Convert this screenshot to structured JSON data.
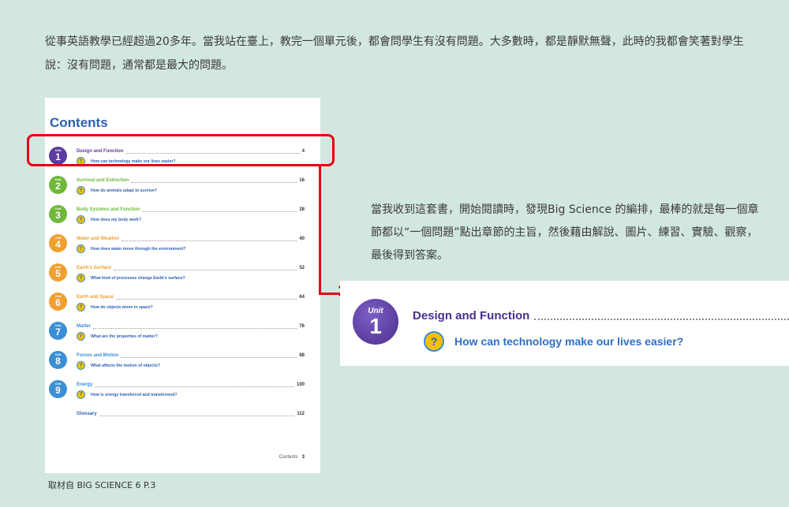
{
  "intro": {
    "text": "從事英語教學已經超過20多年。當我站在臺上，教完一個單元後，都會問學生有沒有問題。大多數時，都是靜默無聲，此時的我都會笑著對學生說：沒有問題，通常都是最大的問題。"
  },
  "toc": {
    "title": "Contents",
    "unit_word": "Unit",
    "units": [
      {
        "number": "1",
        "chapter": "Design and Function",
        "page": "4",
        "question": "How can technology make our lives easier?",
        "color": "#5b3c9e"
      },
      {
        "number": "2",
        "chapter": "Survival and Extinction",
        "page": "16",
        "question": "How do animals adapt to survive?",
        "color": "#6fb83b"
      },
      {
        "number": "3",
        "chapter": "Body Systems and Function",
        "page": "28",
        "question": "How does my body work?",
        "color": "#6fb83b"
      },
      {
        "number": "4",
        "chapter": "Water and Weather",
        "page": "40",
        "question": "How does water move through the environment?",
        "color": "#f0a030"
      },
      {
        "number": "5",
        "chapter": "Earth's Surface",
        "page": "52",
        "question": "What kind of processes change Earth's surface?",
        "color": "#f0a030"
      },
      {
        "number": "6",
        "chapter": "Earth and Space",
        "page": "64",
        "question": "How do objects move in space?",
        "color": "#f0a030"
      },
      {
        "number": "7",
        "chapter": "Matter",
        "page": "76",
        "question": "What are the properties of matter?",
        "color": "#3b8fd4"
      },
      {
        "number": "8",
        "chapter": "Forces and Motion",
        "page": "88",
        "question": "What affects the motion of objects?",
        "color": "#3b8fd4"
      },
      {
        "number": "9",
        "chapter": "Energy",
        "page": "100",
        "question": "How is energy transferred and transformed?",
        "color": "#3b8fd4"
      }
    ],
    "glossary": {
      "label": "Glossary",
      "page": "112"
    },
    "footer": {
      "label": "Contents",
      "page": "3"
    }
  },
  "source": "取材自 BIG SCIENCE 6 P.3",
  "side_text": "當我收到這套書，開始閱讀時，發現Big Science 的編排，最棒的就是每一個章節都以“一個問題”點出章節的主旨，然後藉由解說、圖片、練習、實驗、觀察，最後得到答案。",
  "zoom": {
    "unit_word": "Unit",
    "unit_number": "1",
    "chapter": "Design and Function",
    "question": "How can technology make our lives easier?"
  },
  "colors": {
    "background": "#d3e7e1",
    "highlight": "#e60012",
    "title_blue": "#2f5fb0",
    "unit1_purple": "#5b3c9e"
  },
  "icons": [
    "question-icon"
  ]
}
